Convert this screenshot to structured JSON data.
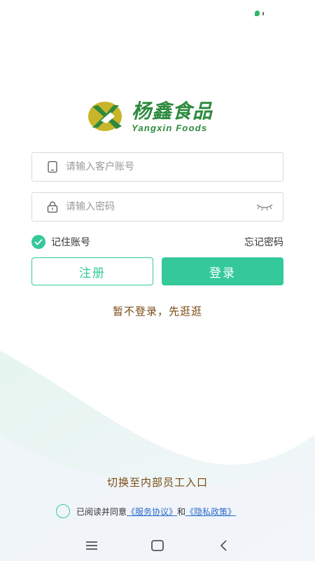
{
  "brand": {
    "name_cn": "杨鑫食品",
    "name_en": "Yangxin Foods",
    "color": "#2d8a3e"
  },
  "form": {
    "account_placeholder": "请输入客户账号",
    "account_value": "",
    "password_placeholder": "请输入密码",
    "password_value": "",
    "remember_label": "记住账号",
    "remember_checked": true,
    "forgot_label": "忘记密码"
  },
  "buttons": {
    "register_label": "注册",
    "login_label": "登录"
  },
  "links": {
    "guest_label": "暂不登录，先逛逛",
    "staff_label": "切换至内部员工入口"
  },
  "agreement": {
    "prefix": "已阅读并同意",
    "service_link": "《服务协议》",
    "conjunction": "和",
    "privacy_link": "《隐私政策》"
  },
  "colors": {
    "accent": "#35c99a",
    "brown_text": "#7a4a14",
    "link": "#2a6cc9"
  },
  "icons": {
    "account": "phone-icon",
    "password": "lock-icon",
    "toggle": "eye-closed-icon",
    "check": "check-icon",
    "nav": [
      "menu-icon",
      "home-icon",
      "back-icon"
    ]
  }
}
